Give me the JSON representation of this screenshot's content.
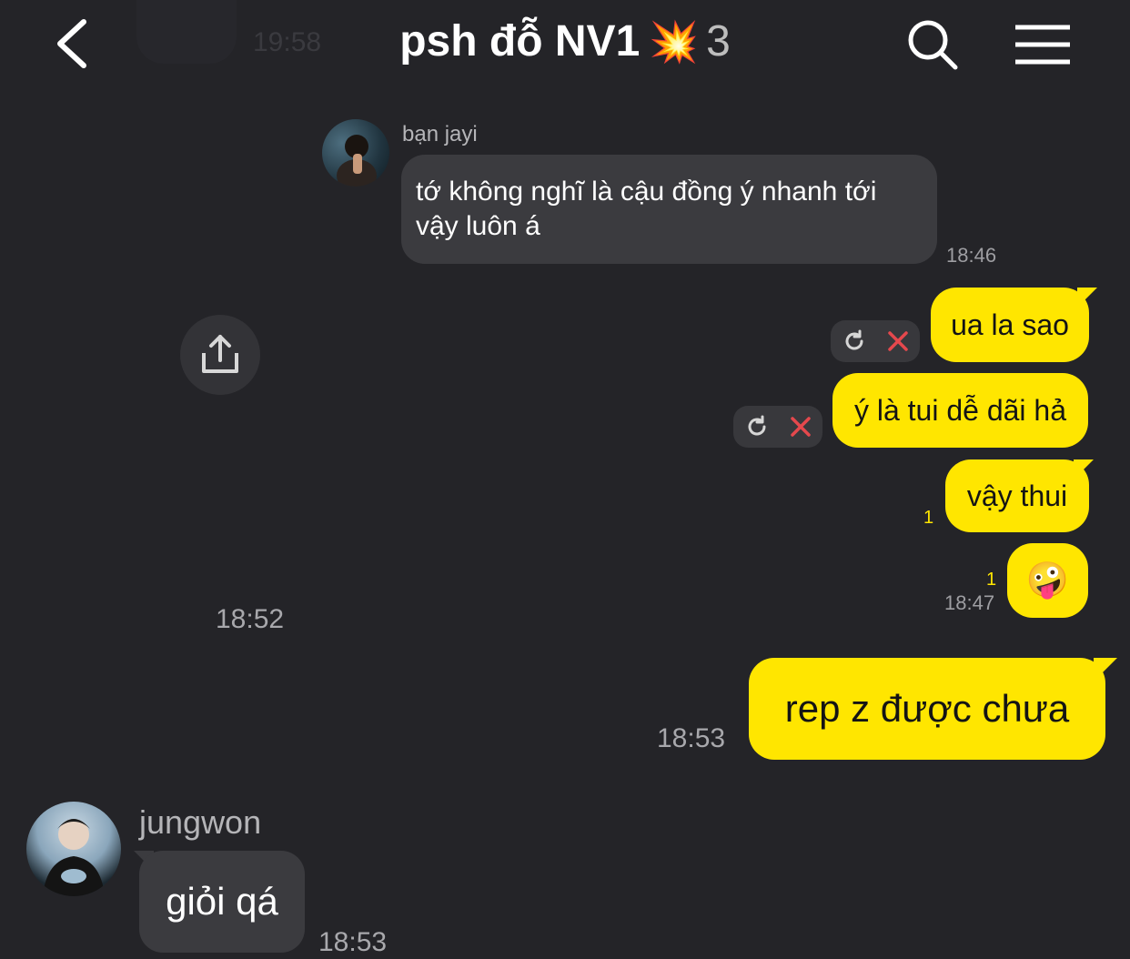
{
  "header": {
    "title": "psh đỗ NV1",
    "title_emoji": "💥",
    "member_count": "3",
    "ghost_time": "19:58"
  },
  "messages": {
    "jayi": {
      "sender": "bạn jayi",
      "text": "tớ không nghĩ là cậu đồng ý nhanh tới vậy luôn á",
      "time": "18:46"
    },
    "out1": {
      "text": "ua la sao"
    },
    "out2": {
      "text": "ý là tui dễ dãi hả"
    },
    "out3": {
      "text": "vậy thui",
      "unread": "1"
    },
    "out4": {
      "text": "🤪",
      "unread": "1",
      "time": "18:47"
    },
    "share_time": "18:52",
    "out5": {
      "text": "rep z được chưa",
      "time": "18:53"
    },
    "jungwon": {
      "sender": "jungwon",
      "text": "giỏi qá",
      "time": "18:53"
    }
  },
  "icons": {
    "back": "chevron-left-icon",
    "search": "search-icon",
    "menu": "hamburger-menu-icon",
    "share": "share-icon",
    "retry": "retry-icon",
    "delete": "close-icon"
  },
  "colors": {
    "background": "#242428",
    "incoming_bubble": "#3b3b3f",
    "outgoing_bubble": "#ffe600",
    "unread": "#ffe600",
    "delete_x": "#e5484d"
  }
}
